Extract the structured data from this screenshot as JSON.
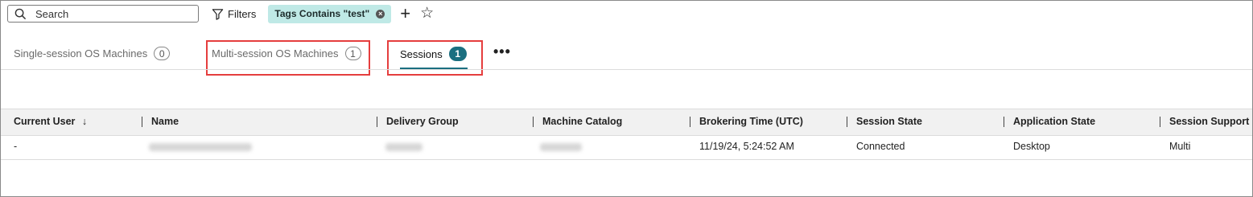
{
  "toolbar": {
    "search_placeholder": "Search",
    "filters_label": "Filters",
    "filter_chip_label": "Tags Contains \"test\"",
    "chip_remove_glyph": "×",
    "add_glyph": "+",
    "favorite_glyph": "☆"
  },
  "tabs": [
    {
      "label": "Single-session OS Machines",
      "count": "0"
    },
    {
      "label": "Multi-session OS Machines",
      "count": "1"
    },
    {
      "label": "Sessions",
      "count": "1"
    }
  ],
  "more_glyph": "•••",
  "table": {
    "columns": [
      "Current User",
      "Name",
      "Delivery Group",
      "Machine Catalog",
      "Brokering Time (UTC)",
      "Session State",
      "Application State",
      "Session Support"
    ],
    "sort_glyph": "↓",
    "rows": [
      {
        "current_user": "-",
        "name": "",
        "delivery_group": "",
        "machine_catalog": "",
        "brokering_time": "11/19/24, 5:24:52 AM",
        "session_state": "Connected",
        "application_state": "Desktop",
        "session_support": "Multi"
      }
    ]
  },
  "colors": {
    "accent": "#1b6f80",
    "chip_bg": "#bfe9e6",
    "highlight": "#e53e3e"
  }
}
